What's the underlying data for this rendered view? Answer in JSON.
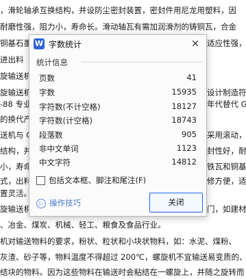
{
  "document": {
    "lines": [
      "，滑轮轴承互换结构，并设防尘密封装置，密封件用尼龙用塑料，因",
      "    耐磨性强，阻力小，寿命长。滑动轴瓦有需加润滑剂的铸铜瓦，合金",
      "铜基石墨",
      "    进出料",
      "旋输送机",
      "旋输送机",
      "-88 专业",
      "的换代产",
      "送机与 G",
      "结构，并",
      "小，寿命",
      "式，出料",
      "置灵活。",
      "旋输送机",
      "、冶金、煤炭、机械、轻工、粮食及食品行业。",
      "机对输送物料的要求，粉状、粒状和小块状物料，如：水泥、煤粉、",
      "灰渣、砂子等，物料温度不得超过 200℃，螺旋机不宜输送易变质的、",
      "结块的物料。因为这些物料在输送时会粘结在一螺旋上，并随之旋转而"
    ],
    "right_fragments": [
      "适应性强，",
      "设计制造符",
      "年代替代 G",
      "采用滚动，",
      "封性好，耐",
      "铁瓦和铜基",
      "修方便，适",
      "门，如建材"
    ]
  },
  "dialog": {
    "logo_letter": "W",
    "title": "字数统计",
    "close_symbol": "×",
    "section_title": "统计信息",
    "stats": [
      {
        "label": "页数",
        "value": "41"
      },
      {
        "label": "字数",
        "value": "15935"
      },
      {
        "label": "字符数(不计空格)",
        "value": "18127"
      },
      {
        "label": "字符数(计空格)",
        "value": "18743"
      },
      {
        "label": "段落数",
        "value": "905"
      },
      {
        "label": "非中文单词",
        "value": "1123"
      },
      {
        "label": "中文字符",
        "value": "14812"
      }
    ],
    "checkbox_label": "包括文本框、脚注和尾注(F)",
    "checkbox_checked": false,
    "tips_icon": "▷",
    "tips_label": "操作技巧",
    "close_button_label": "关闭"
  }
}
